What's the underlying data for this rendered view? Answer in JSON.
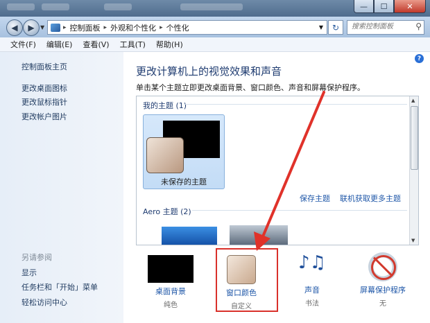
{
  "window": {
    "controls": {
      "minimize": "—",
      "maximize": "☐",
      "close": "✕"
    }
  },
  "address": {
    "crumbs": [
      "控制面板",
      "外观和个性化",
      "个性化"
    ],
    "search_placeholder": "搜索控制面板"
  },
  "menu": [
    "文件(F)",
    "编辑(E)",
    "查看(V)",
    "工具(T)",
    "帮助(H)"
  ],
  "sidebar": {
    "home": "控制面板主页",
    "links": [
      "更改桌面图标",
      "更改鼠标指针",
      "更改帐户图片"
    ],
    "see_also_title": "另请参阅",
    "see_also": [
      "显示",
      "任务栏和「开始」菜单",
      "轻松访问中心"
    ]
  },
  "main": {
    "heading": "更改计算机上的视觉效果和声音",
    "description": "单击某个主题立即更改桌面背景、窗口颜色、声音和屏幕保护程序。",
    "my_themes_label": "我的主题 (1)",
    "unsaved_theme": "未保存的主题",
    "save_theme": "保存主题",
    "get_more_themes": "联机获取更多主题",
    "aero_label": "Aero 主题 (2)"
  },
  "bottom": [
    {
      "label": "桌面背景",
      "value": "纯色",
      "icon": "desktop-background-icon"
    },
    {
      "label": "窗口颜色",
      "value": "自定义",
      "icon": "window-color-icon"
    },
    {
      "label": "声音",
      "value": "书法",
      "icon": "sound-icon"
    },
    {
      "label": "屏幕保护程序",
      "value": "无",
      "icon": "screensaver-icon"
    }
  ],
  "colors": {
    "highlight": "#d9302a",
    "link": "#1f57a8",
    "heading": "#1e3b70"
  }
}
